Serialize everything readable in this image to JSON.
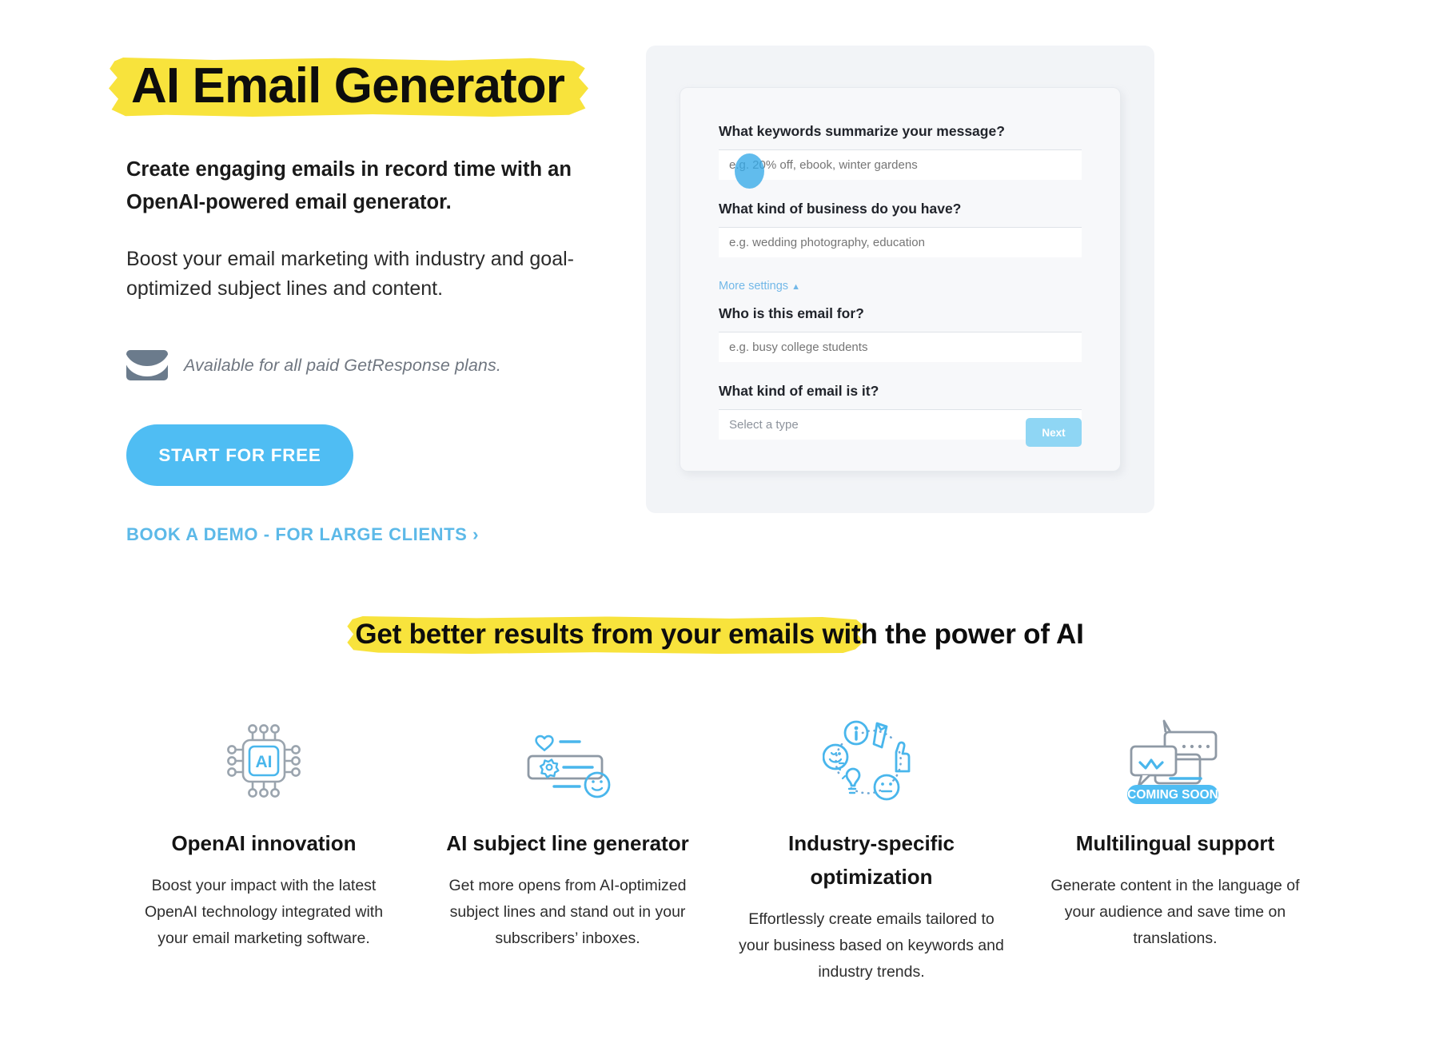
{
  "hero": {
    "title": "AI Email Generator",
    "lead": "Create engaging emails in record time with an OpenAI-powered email generator.",
    "subtext": "Boost your email marketing with industry and goal-optimized subject lines and content.",
    "availability_note": "Available for all paid GetResponse plans.",
    "envelope_icon": "envelope-icon",
    "cta_label": "START FOR FREE",
    "demo_link_label": "BOOK A DEMO - FOR LARGE CLIENTS ›",
    "highlight_color": "#F8E33C",
    "accent_color": "#4fbdf3"
  },
  "product_panel": {
    "fields": [
      {
        "label": "What keywords summarize your message?",
        "placeholder": "e.g. 20% off, ebook, winter gardens",
        "value": "",
        "type": "text"
      },
      {
        "label": "What kind of business do you have?",
        "placeholder": "e.g. wedding photography, education",
        "value": "",
        "type": "text"
      },
      {
        "label": "Who is this email for?",
        "placeholder": "e.g. busy college students",
        "value": "",
        "type": "text"
      }
    ],
    "more_settings_label": "More settings",
    "more_settings_caret": "▲",
    "select_label": "What kind of email is it?",
    "select_value": "Select a type",
    "select_caret": "⌄",
    "next_label": "Next",
    "cursor_indicator": "cursor-blob"
  },
  "section": {
    "heading_highlighted": "Get better results from your emails",
    "heading_rest": " with the power of AI"
  },
  "features": [
    {
      "icon": "ai-chip-icon",
      "title": "OpenAI innovation",
      "description": "Boost your impact with the latest OpenAI technology integrated with your email marketing software."
    },
    {
      "icon": "subject-line-icon",
      "title": "AI subject line generator",
      "description": "Get more opens from AI-optimized subject lines and stand out in your subscribers’ inboxes."
    },
    {
      "icon": "industry-optimization-icon",
      "title": "Industry-specific optimization",
      "description": "Effortlessly create emails tailored to your business based on keywords and industry trends."
    },
    {
      "icon": "multilingual-icon",
      "title": "Multilingual support",
      "description": "Generate content in the language of your audience and save time on translations.",
      "badge": "COMING SOON"
    }
  ]
}
